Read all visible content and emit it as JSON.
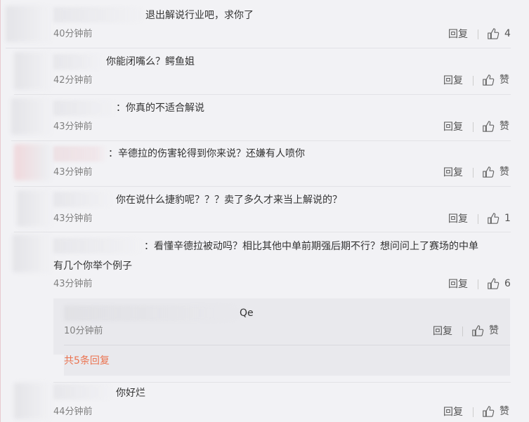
{
  "reply_label": "回复",
  "like_label": "赞",
  "comments": [
    {
      "text": "退出解说行业吧，求你了",
      "time": "40分钟前",
      "likes": "4"
    },
    {
      "text": "你能闭嘴么？鳄鱼姐",
      "time": "42分钟前",
      "likes": "赞"
    },
    {
      "text": "：你真的不适合解说",
      "time": "43分钟前",
      "likes": "赞"
    },
    {
      "text": "：辛德拉的伤害轮得到你来说？还嫌有人喷你",
      "time": "43分钟前",
      "likes": "赞"
    },
    {
      "text": "你在说什么捷豹呢？？？卖了多久才来当上解说的？",
      "time": "43分钟前",
      "likes": "1"
    },
    {
      "text_line1": "：看懂辛德拉被动吗？相比其他中单前期强后期不行？想问问上了赛场的中单",
      "text_line2": "有几个你举个例子",
      "time": "43分钟前",
      "likes": "6"
    },
    {
      "text": "你好烂",
      "time": "44分钟前",
      "likes": "赞"
    }
  ],
  "sub_reply": {
    "text": "Qe",
    "time": "10分钟前",
    "likes": "赞"
  },
  "more_replies": "共5条回复",
  "colors": {
    "accent": "#eb7350",
    "background": "#f2f2f5"
  }
}
